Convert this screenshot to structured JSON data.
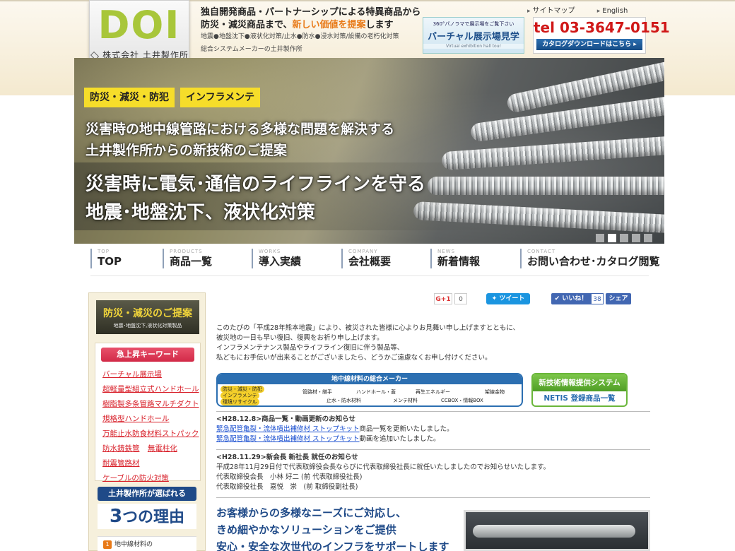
{
  "header": {
    "logo_word": "DOI",
    "logo_sub": "株式会社 土井製作所",
    "tagline1": "独自開発商品・パートナーシップによる特異商品から",
    "tagline2_a": "防災・減災商品まで、",
    "tagline2_hl": "新しい価値を提案",
    "tagline2_b": "します",
    "tagline3": "地震●地盤沈下●液状化対策/止水●防水●浸水対策/設備の老朽化対策",
    "tagline4": "総合システムメーカーの土井製作所",
    "sitemap": "サイトマップ",
    "english": "English",
    "vr_small": "360°パノラマで展示場をご覧下さい",
    "vr_main": "バーチャル展示場見学",
    "vr_en": "Virtual exhibition hall tour",
    "tel": "tel 03-3647-0151",
    "catalog_btn": "カタログダウンロードはこちら ▸"
  },
  "hero": {
    "badge1": "防災・減災・防犯",
    "badge2": "インフラメンテ",
    "line1": "災害時の地中線管路における多様な問題を解決する",
    "line2": "土井製作所からの新技術のご提案",
    "line3": "災害時に電気･通信のライフラインを守る",
    "line4": "地震･地盤沈下、液状化対策",
    "slide_count": 5,
    "active_slide": 2
  },
  "nav": [
    {
      "en": "TOP",
      "jp": "TOP"
    },
    {
      "en": "PRODUCTS",
      "jp": "商品一覧"
    },
    {
      "en": "WORKS",
      "jp": "導入実績"
    },
    {
      "en": "COMPANY",
      "jp": "会社概要"
    },
    {
      "en": "NEWS",
      "jp": "新着情報"
    },
    {
      "en": "CONTACT",
      "jp": "お問い合わせ･カタログ閲覧"
    }
  ],
  "sidebar": {
    "banner_main": "防災・減災のご提案",
    "banner_sub": "地震･地盤沈下,液状化対策製品",
    "keyword_title": "急上昇キーワード",
    "keywords": [
      "バーチャル展示場",
      "超軽量型組立式ハンドホール",
      "樹脂製多条管路マルチダクト",
      "規格型ハンドホール",
      "万能止水防食材料ストパック",
      "防水鋳鉄管",
      "無電柱化",
      "耐震管路材",
      "ケーブルの防火対策"
    ],
    "reason_title": "土井製作所が選ばれる",
    "reason_num": "3",
    "reason_text": "つの理由",
    "reason1_num": "1",
    "reason1_text": "地中線材料の"
  },
  "social": {
    "gplus": "G+1",
    "gplus_count": "0",
    "tweet": "ツイート",
    "like": "いいね！",
    "like_count": "38",
    "share": "シェア"
  },
  "message": [
    "このたびの「平成28年熊本地震」により、被災された皆様に心よりお見舞い申し上げますとともに、",
    "被災地の一日も早い復旧、復興をお祈り申し上げます。",
    "インフラメンテナンス製品やライフライン復旧に伴う製品等、",
    "私どもにお手伝いが出来ることがございましたら、どうかご遠慮なくお申し付けください。"
  ],
  "materials_banner": {
    "title": "地中線材料の総合メーカー",
    "tags_yellow": [
      "防災・減災・防犯",
      "インフラメンテ",
      "環境リサイクル"
    ],
    "tags": [
      "管路材・継手",
      "ハンドホール・蓋",
      "再生エネルギー",
      "架線金物",
      "止水・防水材料",
      "メンテ材料",
      "CCBOX・情報BOX"
    ]
  },
  "netis": {
    "title": "新技術情報提供システム",
    "sub": "NETIS 登録商品一覧"
  },
  "news": [
    {
      "title": "<H28.12.8>商品一覧・動画更新のお知らせ",
      "lines": [
        {
          "link": "緊急配管亀裂・流体噴出補修材 ストップキット",
          "text": "商品一覧を更新いたしました。"
        },
        {
          "link": "緊急配管亀裂・流体噴出補修材 ストップキット",
          "text": "動画を追加いたしました。"
        }
      ]
    },
    {
      "title": "<H28.11.29>新会長 新社長 就任のお知らせ",
      "body": [
        "平成28年11月29日付で代表取締役会長ならびに代表取締役社長に就任いたしましたのでお知らせいたします。",
        "代表取締役会長　小林 好二 (前 代表取締役社長)",
        "代表取締役社長　嘉悦　崇　(前 取締役副社長)"
      ]
    }
  ],
  "feature": {
    "line1": "お客様からの多様なニーズにご対応し、",
    "line2": "きめ細やかなソリューションをご提供",
    "line3": "安心・安全な次世代のインフラをサポートします"
  }
}
